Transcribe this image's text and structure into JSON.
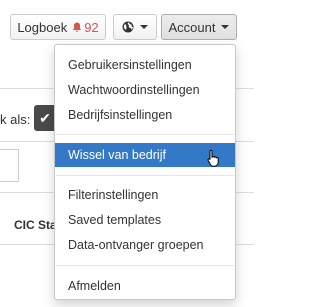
{
  "toolbar": {
    "logboek_label": "Logboek",
    "logboek_count": "92",
    "account_label": "Account"
  },
  "background": {
    "partial_label": "k als:",
    "column_header": "CIC Stat"
  },
  "account_menu": {
    "items": [
      {
        "label": "Gebruikersinstellingen"
      },
      {
        "label": "Wachtwoordinstellingen"
      },
      {
        "label": "Bedrijfsinstellingen"
      },
      {
        "label": "Wissel van bedrijf",
        "active": true
      },
      {
        "label": "Filterinstellingen"
      },
      {
        "label": "Saved templates"
      },
      {
        "label": "Data-ontvanger groepen"
      },
      {
        "label": "Afmelden"
      }
    ]
  },
  "colors": {
    "active_bg": "#3379c7",
    "badge": "#d9534f"
  }
}
